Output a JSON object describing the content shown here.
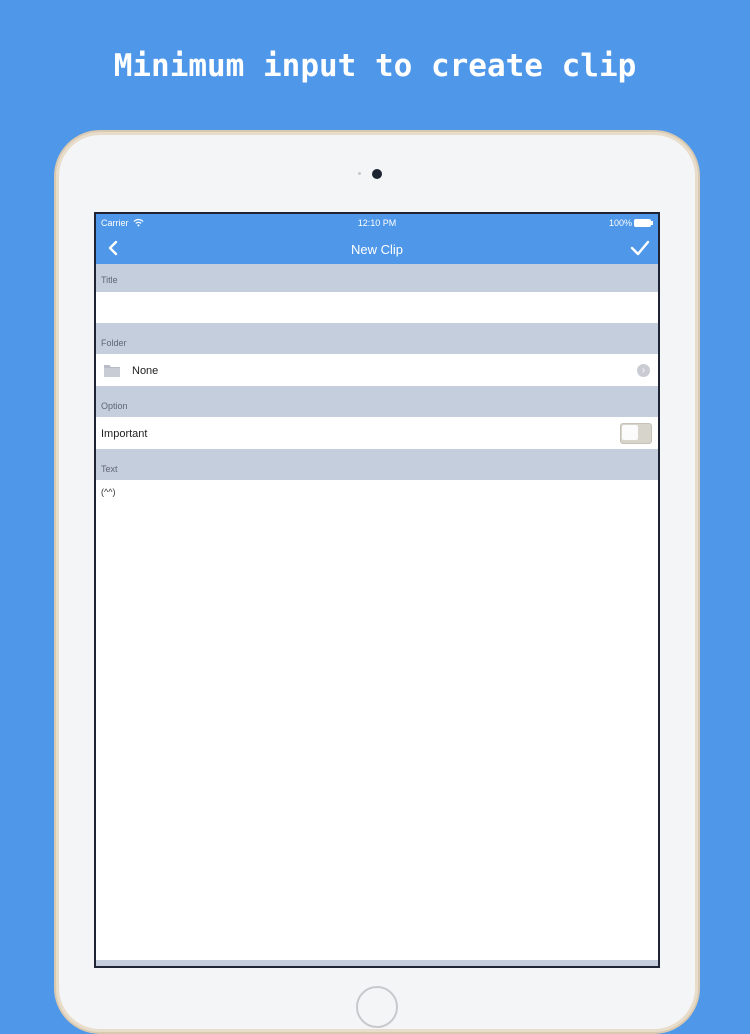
{
  "headline": "Minimum input to create clip",
  "status_bar": {
    "carrier": "Carrier",
    "time": "12:10 PM",
    "battery": "100%"
  },
  "nav": {
    "title": "New Clip",
    "back_icon": "chevron-left-icon",
    "done_icon": "checkmark-icon"
  },
  "sections": {
    "title_header": "Title",
    "title_value": "",
    "folder_header": "Folder",
    "folder_value": "None",
    "option_header": "Option",
    "important_label": "Important",
    "important_on": false,
    "text_header": "Text",
    "text_value": "(^^)"
  },
  "colors": {
    "accent": "#4f97e8",
    "section_header": "#c5cedd"
  }
}
